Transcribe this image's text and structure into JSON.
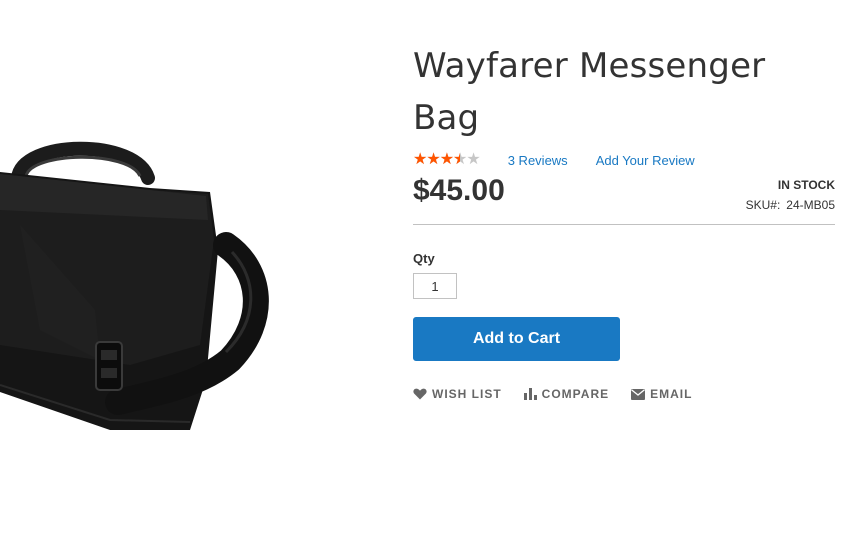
{
  "product": {
    "name": "Wayfarer Messenger Bag",
    "price": "$45.00",
    "stock_status": "IN STOCK",
    "sku_label": "SKU#:",
    "sku_value": "24-MB05"
  },
  "rating": {
    "stars_max": 5,
    "stars_value": 3.5,
    "star_color": "#ff5501",
    "star_empty_color": "#c7c7c7",
    "reviews_link": "3 Reviews",
    "add_review_link": "Add Your Review"
  },
  "cart": {
    "qty_label": "Qty",
    "qty_value": "1",
    "add_to_cart_label": "Add to Cart",
    "button_color": "#1979c3"
  },
  "actions": [
    {
      "icon": "heart-icon",
      "label": "WISH LIST"
    },
    {
      "icon": "bar-chart-icon",
      "label": "COMPARE"
    },
    {
      "icon": "envelope-icon",
      "label": "EMAIL"
    }
  ]
}
